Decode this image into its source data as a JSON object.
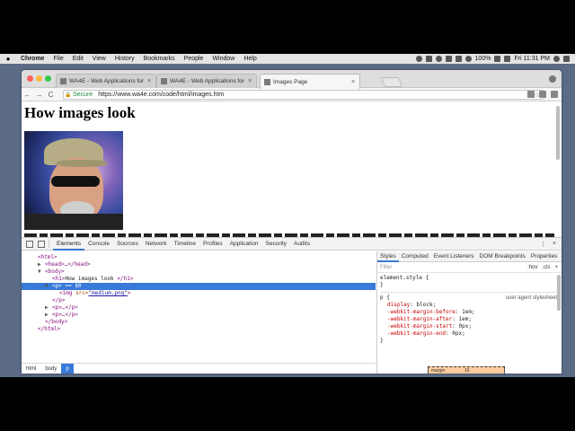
{
  "menubar": {
    "apple": "",
    "app": "Chrome",
    "items": [
      "File",
      "Edit",
      "View",
      "History",
      "Bookmarks",
      "People",
      "Window",
      "Help"
    ],
    "battery": "100%",
    "clock": "Fri 11:31 PM"
  },
  "tabs": [
    {
      "label": "WA4E - Web Applications for E",
      "close": "×"
    },
    {
      "label": "WA4E - Web Applications for E",
      "close": "×"
    },
    {
      "label": "Images Page",
      "close": "×"
    }
  ],
  "toolbar": {
    "back": "←",
    "forward": "→",
    "reload": "C",
    "lock": "🔒",
    "secure": "Secure",
    "url": "https://www.wa4e.com/code/html/images.htm",
    "search_icon": "⌕",
    "star_icon": "☆"
  },
  "page": {
    "heading": "How images look"
  },
  "devtools": {
    "tabs": [
      "Elements",
      "Console",
      "Sources",
      "Network",
      "Timeline",
      "Profiles",
      "Application",
      "Security",
      "Audits"
    ],
    "menu_icon": "⋮",
    "close_icon": "×",
    "dom": [
      {
        "indent": 0,
        "arrow": "",
        "open": "<html>",
        "rest": ""
      },
      {
        "indent": 1,
        "arrow": "▶",
        "open": "<head>",
        "rest": "…</head>"
      },
      {
        "indent": 1,
        "arrow": "▼",
        "open": "<body>",
        "rest": ""
      },
      {
        "indent": 2,
        "arrow": "",
        "open": "<h1>",
        "text": "How images look ",
        "close": "</h1>"
      },
      {
        "indent": 2,
        "arrow": "▼",
        "open": "<p>",
        "rest": " == $0",
        "selected": true
      },
      {
        "indent": 3,
        "arrow": "",
        "open": "<img ",
        "attr": "src=",
        "val": "\"medium.png\"",
        "close": ">"
      },
      {
        "indent": 2,
        "arrow": "",
        "open": "</p>",
        "rest": ""
      },
      {
        "indent": 2,
        "arrow": "▶",
        "open": "<p>",
        "rest": "…</p>"
      },
      {
        "indent": 2,
        "arrow": "▶",
        "open": "<p>",
        "rest": "…</p>"
      },
      {
        "indent": 1,
        "arrow": "",
        "open": "</body>",
        "rest": ""
      },
      {
        "indent": 0,
        "arrow": "",
        "open": "</html>",
        "rest": ""
      }
    ],
    "selected_dots": "...",
    "breadcrumbs": [
      "html",
      "body",
      "p"
    ],
    "side_tabs": [
      "Styles",
      "Computed",
      "Event Listeners",
      "DOM Breakpoints",
      "Properties"
    ],
    "filter_placeholder": "Filter",
    "hov": ":hov",
    "cls": ".cls",
    "plus": "+",
    "element_style_open": "element.style {",
    "element_style_close": "}",
    "rule_selector": "p {",
    "rule_source": "user agent stylesheet",
    "declarations": [
      {
        "prop": "display",
        "value": "block;"
      },
      {
        "prop": "-webkit-margin-before",
        "value": "1em;"
      },
      {
        "prop": "-webkit-margin-after",
        "value": "1em;"
      },
      {
        "prop": "-webkit-margin-start",
        "value": "0px;"
      },
      {
        "prop": "-webkit-margin-end",
        "value": "0px;"
      }
    ],
    "rule_close": "}",
    "box_label": "margin",
    "box_value": "16"
  }
}
